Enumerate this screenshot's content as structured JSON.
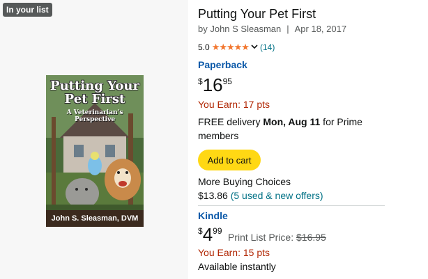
{
  "badge": {
    "label": "In your list"
  },
  "cover": {
    "title": "Putting Your Pet First",
    "subtitle": "A Veterinarian's Perspective",
    "author": "John S. Sleasman, DVM"
  },
  "product": {
    "title": "Putting Your Pet First",
    "by_label": "by John S Sleasman",
    "separator": "|",
    "date": "Apr 18, 2017",
    "rating_value": "5.0",
    "stars": "★★★★★",
    "rating_count": "(14)"
  },
  "paperback": {
    "label": "Paperback",
    "currency": "$",
    "price_whole": "16",
    "price_fraction": "95",
    "earn": "You Earn: 17 pts",
    "delivery_prefix": "FREE delivery ",
    "delivery_date": "Mon, Aug 11",
    "delivery_suffix": " for Prime members",
    "add_to_cart": "Add to cart",
    "more_buying": "More Buying Choices",
    "more_price": "$13.86",
    "offers_link": "(5 used & new offers)"
  },
  "kindle": {
    "label": "Kindle",
    "currency": "$",
    "price_whole": "4",
    "price_fraction": "99",
    "list_price_label": "Print List Price:",
    "list_price": "$16.95",
    "earn": "You Earn: 15 pts",
    "availability": "Available instantly"
  },
  "colors": {
    "link": "#007185",
    "format_link": "#0a58a8",
    "earn": "#b12704",
    "star": "#f2762e",
    "button": "#ffd814"
  }
}
